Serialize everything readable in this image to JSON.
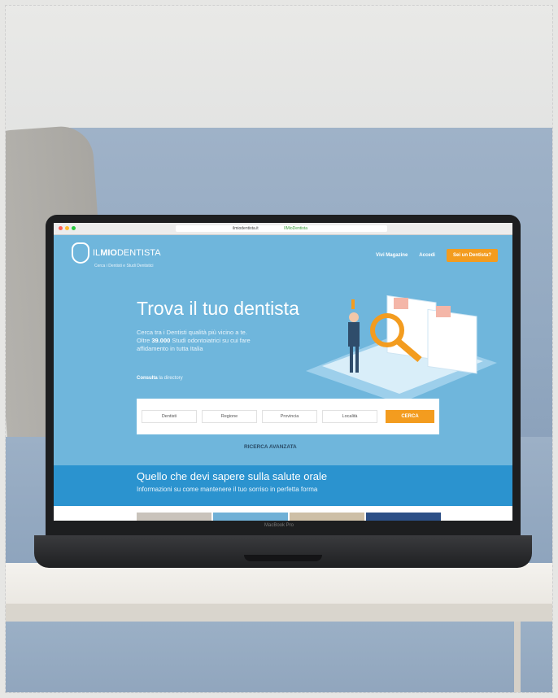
{
  "browser": {
    "url": "ilmiodentista.it",
    "ssl_label": "IlMioDentista"
  },
  "site": {
    "logo": {
      "prefix": "IL",
      "bold": "MIO",
      "suffix": "DENTISTA",
      "tagline": "Cerca i Dentisti e Studi Dentistici"
    },
    "nav": {
      "magazine": "Vivi Magazine",
      "login": "Accedi",
      "cta": "Sei un Dentista?"
    },
    "hero": {
      "title": "Trova il tuo dentista",
      "text_1": "Cerca tra i Dentisti qualità più vicino a te.",
      "text_2a": "Oltre ",
      "text_2b": "39.000",
      "text_2c": " Studi odontoiatrici su cui fare",
      "text_3": "affidamento in tutta Italia",
      "consulta_bold": "Consulta",
      "consulta_rest": " la directory"
    },
    "search": {
      "fields": [
        "Dentisti",
        "Regione",
        "Provincia",
        "Località"
      ],
      "button": "CERCA"
    },
    "advanced_search": "RICERCA AVANZATA",
    "section": {
      "title": "Quello che devi sapere sulla salute orale",
      "subtitle": "Informazioni su come mantenere il tuo sorriso in perfetta forma"
    }
  },
  "device_label": "MacBook Pro",
  "colors": {
    "screen_bg": "#6fb6dc",
    "accent_orange": "#f39c1f",
    "section_blue": "#2b93cf"
  }
}
